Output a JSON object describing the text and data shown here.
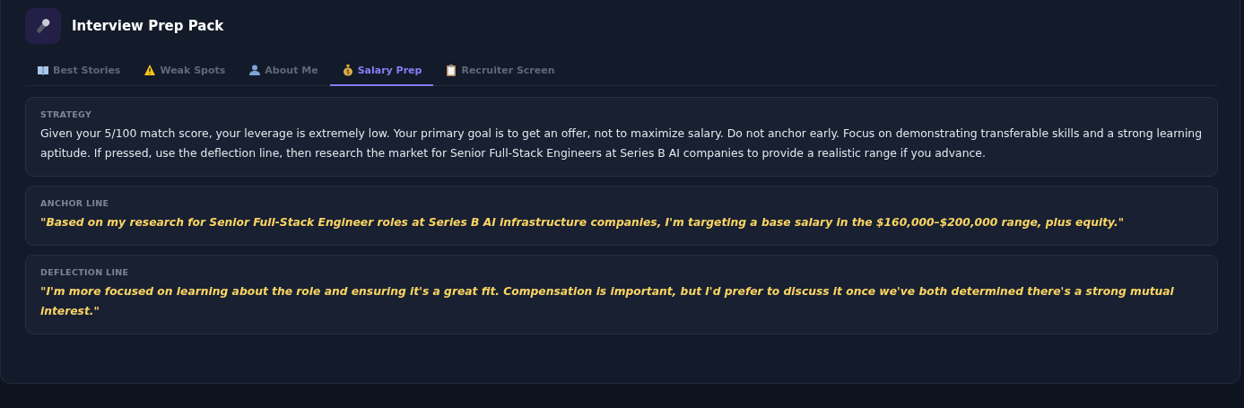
{
  "header": {
    "title": "Interview Prep Pack"
  },
  "tabs": [
    {
      "label": "Best Stories",
      "selected": false
    },
    {
      "label": "Weak Spots",
      "selected": false
    },
    {
      "label": "About Me",
      "selected": false
    },
    {
      "label": "Salary Prep",
      "selected": true
    },
    {
      "label": "Recruiter Screen",
      "selected": false
    }
  ],
  "cards": [
    {
      "kind": "plain",
      "label": "STRATEGY",
      "text": "Given your 5/100 match score, your leverage is extremely low. Your primary goal is to get an offer, not to maximize salary. Do not anchor early. Focus on demonstrating transferable skills and a strong learning aptitude. If pressed, use the deflection line, then research the market for Senior Full-Stack Engineers at Series B AI companies to provide a realistic range if you advance."
    },
    {
      "kind": "quote",
      "label": "ANCHOR LINE",
      "text": "\"Based on my research for Senior Full-Stack Engineer roles at Series B AI infrastructure companies, I'm targeting a base salary in the $160,000–$200,000 range, plus equity.\""
    },
    {
      "kind": "quote",
      "label": "DEFLECTION LINE",
      "text": "\"I'm more focused on learning about the role and ensuring it's a great fit. Compensation is important, but I'd prefer to discuss it once we've both determined there's a strong mutual interest.\""
    }
  ]
}
